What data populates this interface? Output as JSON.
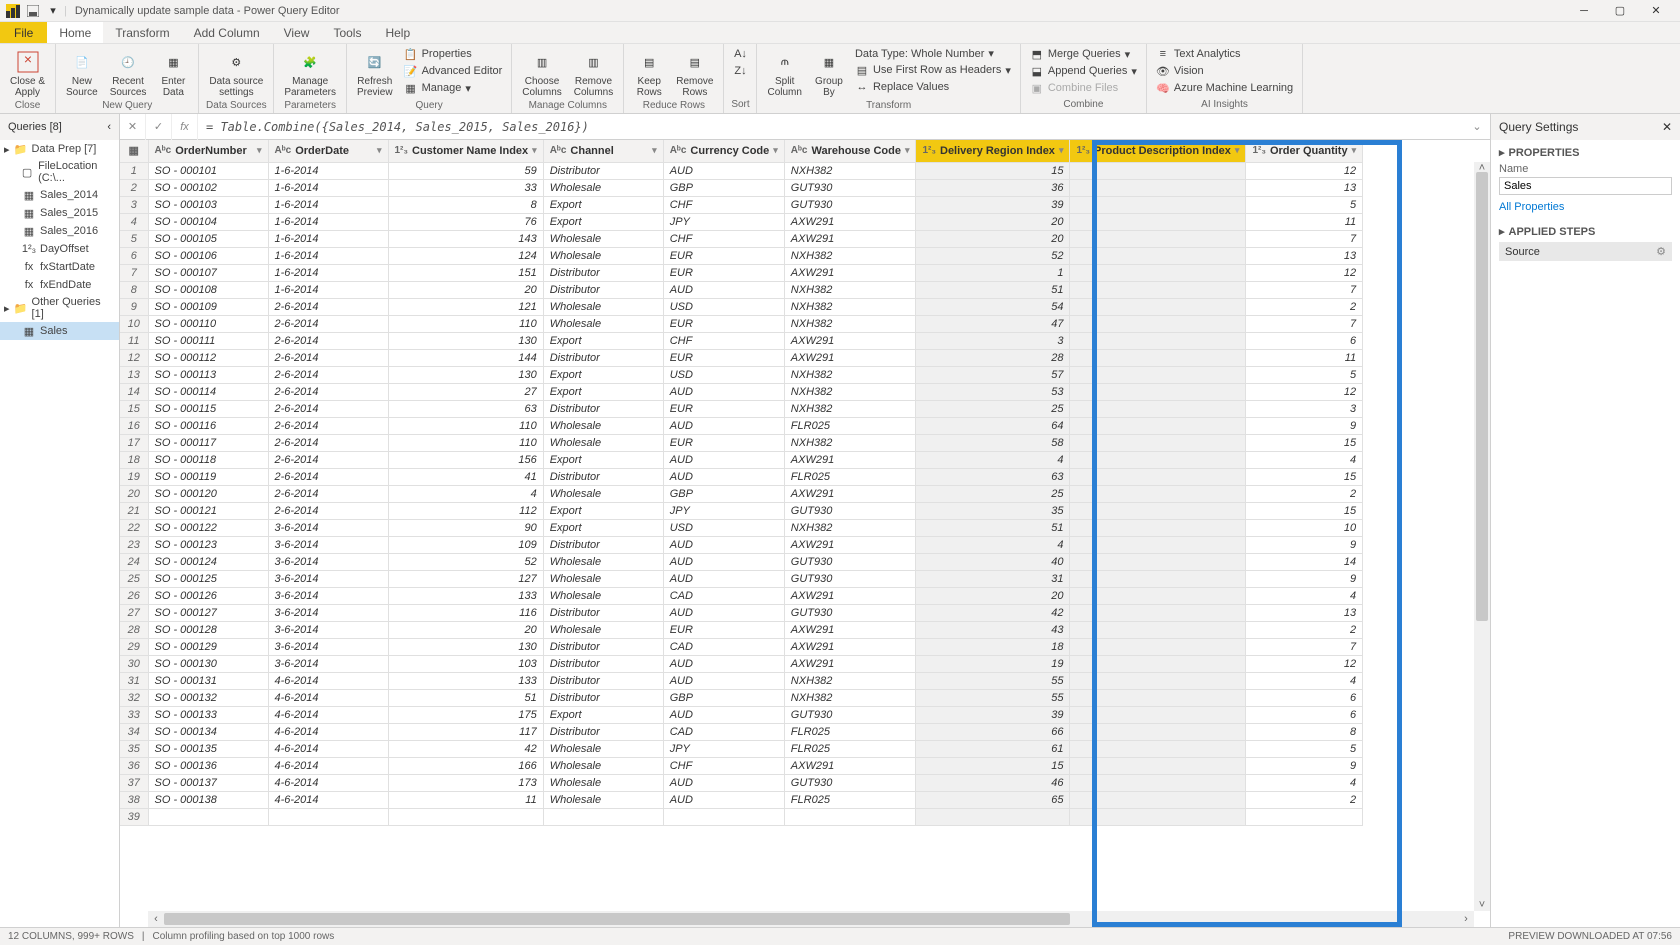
{
  "window": {
    "title": "Dynamically update sample data - Power Query Editor"
  },
  "menu": {
    "file": "File",
    "tabs": [
      "Home",
      "Transform",
      "Add Column",
      "View",
      "Tools",
      "Help"
    ],
    "active": "Home"
  },
  "ribbon": {
    "close": {
      "close_apply": "Close &\nApply",
      "group": "Close"
    },
    "new_query": {
      "new_source": "New\nSource",
      "recent_sources": "Recent\nSources",
      "enter_data": "Enter\nData",
      "group": "New Query"
    },
    "data_sources": {
      "settings": "Data source\nsettings",
      "group": "Data Sources"
    },
    "parameters": {
      "manage": "Manage\nParameters",
      "group": "Parameters"
    },
    "query": {
      "refresh": "Refresh\nPreview",
      "properties": "Properties",
      "advanced": "Advanced Editor",
      "manage": "Manage",
      "group": "Query"
    },
    "manage_cols": {
      "choose": "Choose\nColumns",
      "remove": "Remove\nColumns",
      "group": "Manage Columns"
    },
    "reduce_rows": {
      "keep": "Keep\nRows",
      "remove": "Remove\nRows",
      "group": "Reduce Rows"
    },
    "sort": {
      "group": "Sort"
    },
    "transform": {
      "split": "Split\nColumn",
      "group_by": "Group\nBy",
      "data_type": "Data Type: Whole Number",
      "first_row": "Use First Row as Headers",
      "replace": "Replace Values",
      "group": "Transform"
    },
    "combine": {
      "merge": "Merge Queries",
      "append": "Append Queries",
      "combine_files": "Combine Files",
      "group": "Combine"
    },
    "ai": {
      "text": "Text Analytics",
      "vision": "Vision",
      "aml": "Azure Machine Learning",
      "group": "AI Insights"
    }
  },
  "formula_bar": {
    "formula": "= Table.Combine({Sales_2014, Sales_2015, Sales_2016})"
  },
  "queries_panel": {
    "header": "Queries [8]",
    "folders": [
      {
        "name": "Data Prep [7]",
        "items": [
          "FileLocation (C:\\...",
          "Sales_2014",
          "Sales_2015",
          "Sales_2016",
          "DayOffset",
          "fxStartDate",
          "fxEndDate"
        ]
      },
      {
        "name": "Other Queries [1]",
        "items": [
          "Sales"
        ]
      }
    ],
    "selected": "Sales"
  },
  "grid": {
    "columns": [
      "OrderNumber",
      "OrderDate",
      "Customer Name Index",
      "Channel",
      "Currency Code",
      "Warehouse Code",
      "Delivery Region Index",
      "Product Description Index",
      "Order Quantity"
    ],
    "highlighted_cols": [
      6,
      7
    ],
    "rows": [
      [
        "SO - 000101",
        "1-6-2014",
        59,
        "Distributor",
        "AUD",
        "NXH382",
        15,
        "",
        12
      ],
      [
        "SO - 000102",
        "1-6-2014",
        33,
        "Wholesale",
        "GBP",
        "GUT930",
        36,
        "",
        13
      ],
      [
        "SO - 000103",
        "1-6-2014",
        8,
        "Export",
        "CHF",
        "GUT930",
        39,
        "",
        5
      ],
      [
        "SO - 000104",
        "1-6-2014",
        76,
        "Export",
        "JPY",
        "AXW291",
        20,
        "",
        11
      ],
      [
        "SO - 000105",
        "1-6-2014",
        143,
        "Wholesale",
        "CHF",
        "AXW291",
        20,
        "",
        7
      ],
      [
        "SO - 000106",
        "1-6-2014",
        124,
        "Wholesale",
        "EUR",
        "NXH382",
        52,
        "",
        13
      ],
      [
        "SO - 000107",
        "1-6-2014",
        151,
        "Distributor",
        "EUR",
        "AXW291",
        1,
        "",
        12
      ],
      [
        "SO - 000108",
        "1-6-2014",
        20,
        "Distributor",
        "AUD",
        "NXH382",
        51,
        "",
        7
      ],
      [
        "SO - 000109",
        "2-6-2014",
        121,
        "Wholesale",
        "USD",
        "NXH382",
        54,
        "",
        2
      ],
      [
        "SO - 000110",
        "2-6-2014",
        110,
        "Wholesale",
        "EUR",
        "NXH382",
        47,
        "",
        7
      ],
      [
        "SO - 000111",
        "2-6-2014",
        130,
        "Export",
        "CHF",
        "AXW291",
        3,
        "",
        6
      ],
      [
        "SO - 000112",
        "2-6-2014",
        144,
        "Distributor",
        "EUR",
        "AXW291",
        28,
        "",
        11
      ],
      [
        "SO - 000113",
        "2-6-2014",
        130,
        "Export",
        "USD",
        "NXH382",
        57,
        "",
        5
      ],
      [
        "SO - 000114",
        "2-6-2014",
        27,
        "Export",
        "AUD",
        "NXH382",
        53,
        "",
        12
      ],
      [
        "SO - 000115",
        "2-6-2014",
        63,
        "Distributor",
        "EUR",
        "NXH382",
        25,
        "",
        3
      ],
      [
        "SO - 000116",
        "2-6-2014",
        110,
        "Wholesale",
        "AUD",
        "FLR025",
        64,
        "",
        9
      ],
      [
        "SO - 000117",
        "2-6-2014",
        110,
        "Wholesale",
        "EUR",
        "NXH382",
        58,
        "",
        15
      ],
      [
        "SO - 000118",
        "2-6-2014",
        156,
        "Export",
        "AUD",
        "AXW291",
        4,
        "",
        4
      ],
      [
        "SO - 000119",
        "2-6-2014",
        41,
        "Distributor",
        "AUD",
        "FLR025",
        63,
        "",
        15
      ],
      [
        "SO - 000120",
        "2-6-2014",
        4,
        "Wholesale",
        "GBP",
        "AXW291",
        25,
        "",
        2
      ],
      [
        "SO - 000121",
        "2-6-2014",
        112,
        "Export",
        "JPY",
        "GUT930",
        35,
        "",
        15
      ],
      [
        "SO - 000122",
        "3-6-2014",
        90,
        "Export",
        "USD",
        "NXH382",
        51,
        "",
        10
      ],
      [
        "SO - 000123",
        "3-6-2014",
        109,
        "Distributor",
        "AUD",
        "AXW291",
        4,
        "",
        9
      ],
      [
        "SO - 000124",
        "3-6-2014",
        52,
        "Wholesale",
        "AUD",
        "GUT930",
        40,
        "",
        14
      ],
      [
        "SO - 000125",
        "3-6-2014",
        127,
        "Wholesale",
        "AUD",
        "GUT930",
        31,
        "",
        9
      ],
      [
        "SO - 000126",
        "3-6-2014",
        133,
        "Wholesale",
        "CAD",
        "AXW291",
        20,
        "",
        4
      ],
      [
        "SO - 000127",
        "3-6-2014",
        116,
        "Distributor",
        "AUD",
        "GUT930",
        42,
        "",
        13
      ],
      [
        "SO - 000128",
        "3-6-2014",
        20,
        "Wholesale",
        "EUR",
        "AXW291",
        43,
        "",
        2
      ],
      [
        "SO - 000129",
        "3-6-2014",
        130,
        "Distributor",
        "CAD",
        "AXW291",
        18,
        "",
        7
      ],
      [
        "SO - 000130",
        "3-6-2014",
        103,
        "Distributor",
        "AUD",
        "AXW291",
        19,
        "",
        12
      ],
      [
        "SO - 000131",
        "4-6-2014",
        133,
        "Distributor",
        "AUD",
        "NXH382",
        55,
        "",
        4
      ],
      [
        "SO - 000132",
        "4-6-2014",
        51,
        "Distributor",
        "GBP",
        "NXH382",
        55,
        "",
        6
      ],
      [
        "SO - 000133",
        "4-6-2014",
        175,
        "Export",
        "AUD",
        "GUT930",
        39,
        "",
        6
      ],
      [
        "SO - 000134",
        "4-6-2014",
        117,
        "Distributor",
        "CAD",
        "FLR025",
        66,
        "",
        8
      ],
      [
        "SO - 000135",
        "4-6-2014",
        42,
        "Wholesale",
        "JPY",
        "FLR025",
        61,
        "",
        5
      ],
      [
        "SO - 000136",
        "4-6-2014",
        166,
        "Wholesale",
        "CHF",
        "AXW291",
        15,
        "",
        9
      ],
      [
        "SO - 000137",
        "4-6-2014",
        173,
        "Wholesale",
        "AUD",
        "GUT930",
        46,
        "",
        4
      ],
      [
        "SO - 000138",
        "4-6-2014",
        11,
        "Wholesale",
        "AUD",
        "FLR025",
        65,
        "",
        2
      ]
    ],
    "extra_row": 39
  },
  "settings": {
    "header": "Query Settings",
    "properties": "PROPERTIES",
    "name_label": "Name",
    "name_value": "Sales",
    "all_properties": "All Properties",
    "applied_steps": "APPLIED STEPS",
    "steps": [
      "Source"
    ]
  },
  "statusbar": {
    "left1": "12 COLUMNS, 999+ ROWS",
    "left2": "Column profiling based on top 1000 rows",
    "right": "PREVIEW DOWNLOADED AT 07:56"
  }
}
